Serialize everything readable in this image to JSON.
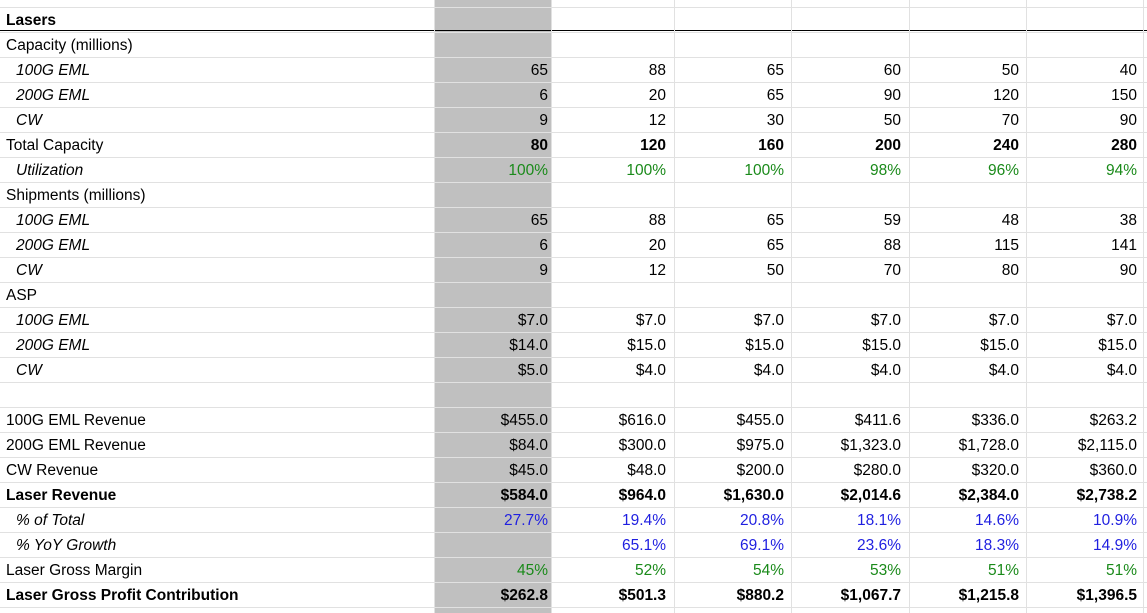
{
  "sheet": {
    "rows": [
      {
        "label": "Lasers",
        "style": "bold-title",
        "values": []
      },
      {
        "label": "Capacity (millions)",
        "style": "plain",
        "values": []
      },
      {
        "label": "100G EML",
        "style": "indent-italic",
        "values": [
          "65",
          "88",
          "65",
          "60",
          "50",
          "40"
        ]
      },
      {
        "label": "200G EML",
        "style": "indent-italic",
        "values": [
          "6",
          "20",
          "65",
          "90",
          "120",
          "150"
        ]
      },
      {
        "label": "CW",
        "style": "indent-italic",
        "values": [
          "9",
          "12",
          "30",
          "50",
          "70",
          "90"
        ]
      },
      {
        "label": "Total Capacity",
        "style": "plain",
        "valueStyle": "bold",
        "values": [
          "80",
          "120",
          "160",
          "200",
          "240",
          "280"
        ]
      },
      {
        "label": "Utilization",
        "style": "indent-italic",
        "valueColor": "green",
        "values": [
          "100%",
          "100%",
          "100%",
          "98%",
          "96%",
          "94%"
        ]
      },
      {
        "label": "Shipments (millions)",
        "style": "plain",
        "values": []
      },
      {
        "label": "100G EML",
        "style": "indent-italic",
        "values": [
          "65",
          "88",
          "65",
          "59",
          "48",
          "38"
        ]
      },
      {
        "label": "200G EML",
        "style": "indent-italic",
        "values": [
          "6",
          "20",
          "65",
          "88",
          "115",
          "141"
        ]
      },
      {
        "label": "CW",
        "style": "indent-italic",
        "values": [
          "9",
          "12",
          "50",
          "70",
          "80",
          "90"
        ]
      },
      {
        "label": "ASP",
        "style": "plain",
        "values": []
      },
      {
        "label": "100G EML",
        "style": "indent-italic",
        "values": [
          "$7.0",
          "$7.0",
          "$7.0",
          "$7.0",
          "$7.0",
          "$7.0"
        ]
      },
      {
        "label": "200G EML",
        "style": "indent-italic",
        "values": [
          "$14.0",
          "$15.0",
          "$15.0",
          "$15.0",
          "$15.0",
          "$15.0"
        ]
      },
      {
        "label": "CW",
        "style": "indent-italic",
        "values": [
          "$5.0",
          "$4.0",
          "$4.0",
          "$4.0",
          "$4.0",
          "$4.0"
        ]
      },
      {
        "label": "",
        "style": "plain",
        "values": []
      },
      {
        "label": "100G EML Revenue",
        "style": "plain",
        "values": [
          "$455.0",
          "$616.0",
          "$455.0",
          "$411.6",
          "$336.0",
          "$263.2"
        ]
      },
      {
        "label": "200G EML Revenue",
        "style": "plain",
        "values": [
          "$84.0",
          "$300.0",
          "$975.0",
          "$1,323.0",
          "$1,728.0",
          "$2,115.0"
        ]
      },
      {
        "label": "CW Revenue",
        "style": "plain",
        "values": [
          "$45.0",
          "$48.0",
          "$200.0",
          "$280.0",
          "$320.0",
          "$360.0"
        ]
      },
      {
        "label": "Laser Revenue",
        "style": "bold",
        "valueStyle": "bold",
        "values": [
          "$584.0",
          "$964.0",
          "$1,630.0",
          "$2,014.6",
          "$2,384.0",
          "$2,738.2"
        ]
      },
      {
        "label": "% of Total",
        "style": "indent-italic",
        "valueColor": "blue",
        "values": [
          "27.7%",
          "19.4%",
          "20.8%",
          "18.1%",
          "14.6%",
          "10.9%"
        ]
      },
      {
        "label": "% YoY Growth",
        "style": "indent-italic",
        "valueColor": "blue",
        "values": [
          "",
          "65.1%",
          "69.1%",
          "23.6%",
          "18.3%",
          "14.9%"
        ]
      },
      {
        "label": "Laser Gross Margin",
        "style": "plain",
        "valueColor": "green",
        "values": [
          "45%",
          "52%",
          "54%",
          "53%",
          "51%",
          "51%"
        ]
      },
      {
        "label": "Laser Gross Profit Contribution",
        "style": "bold",
        "valueStyle": "bold",
        "values": [
          "$262.8",
          "$501.3",
          "$880.2",
          "$1,067.7",
          "$1,215.8",
          "$1,396.5"
        ]
      }
    ]
  },
  "colors": {
    "green": "#1a8a1a",
    "blue": "#1f1fe0",
    "shaded_column": "#c0c0c0",
    "gridline": "#e1e1e1"
  }
}
